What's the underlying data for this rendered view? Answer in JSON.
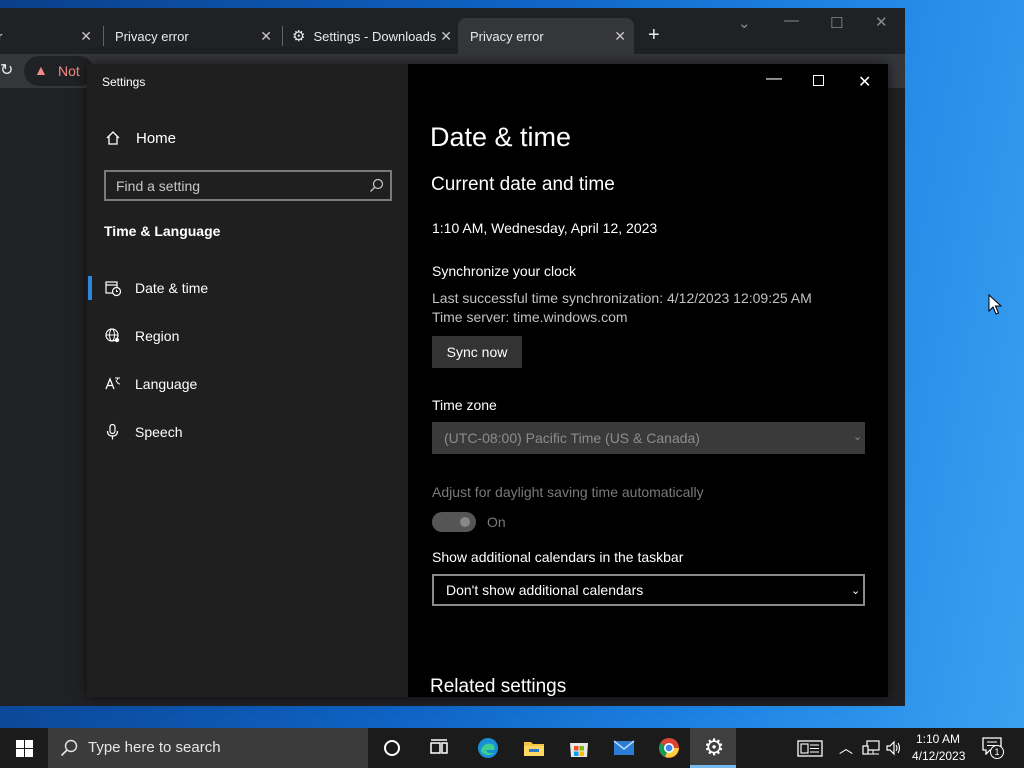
{
  "chrome": {
    "tabs": [
      "Privacy error",
      "Settings - Downloads",
      "Privacy error"
    ],
    "warning_text": "Not"
  },
  "settings": {
    "window_title": "Settings",
    "home_label": "Home",
    "search_placeholder": "Find a setting",
    "section_title": "Time & Language",
    "nav": [
      {
        "label": "Date & time",
        "icon": "calendar-clock-icon"
      },
      {
        "label": "Region",
        "icon": "globe-icon"
      },
      {
        "label": "Language",
        "icon": "language-icon"
      },
      {
        "label": "Speech",
        "icon": "microphone-icon"
      }
    ],
    "main": {
      "page_title": "Date & time",
      "section_heading": "Current date and time",
      "current_datetime": "1:10 AM, Wednesday, April 12, 2023",
      "sync_heading": "Synchronize your clock",
      "last_sync": "Last successful time synchronization: 4/12/2023 12:09:25 AM",
      "time_server": "Time server: time.windows.com",
      "sync_button": "Sync now",
      "timezone_label": "Time zone",
      "timezone_value": "(UTC-08:00) Pacific Time (US & Canada)",
      "dst_label": "Adjust for daylight saving time automatically",
      "dst_state": "On",
      "calendars_label": "Show additional calendars in the taskbar",
      "calendars_value": "Don't show additional calendars",
      "related_heading": "Related settings"
    }
  },
  "taskbar": {
    "search_placeholder": "Type here to search",
    "time": "1:10 AM",
    "date": "4/12/2023",
    "notification_count": "1"
  },
  "colors": {
    "accent": "#2b88d8",
    "desktop": "#0f63c4"
  }
}
